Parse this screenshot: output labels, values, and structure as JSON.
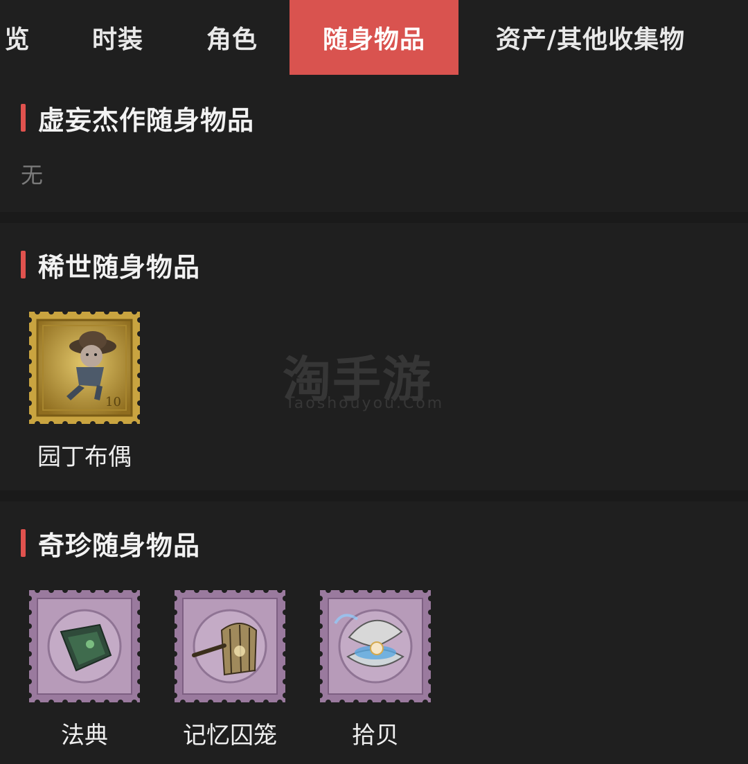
{
  "tabs": [
    {
      "label": "览",
      "active": false
    },
    {
      "label": "时装",
      "active": false
    },
    {
      "label": "角色",
      "active": false
    },
    {
      "label": "随身物品",
      "active": true
    },
    {
      "label": "资产/其他收集物",
      "active": false
    }
  ],
  "sections": [
    {
      "title": "虚妄杰作随身物品",
      "empty_text": "无",
      "items": []
    },
    {
      "title": "稀世随身物品",
      "items": [
        {
          "name": "园丁布偶",
          "rarity": "gold",
          "icon": "gardener-doll-icon"
        }
      ]
    },
    {
      "title": "奇珍随身物品",
      "items": [
        {
          "name": "法典",
          "rarity": "purple",
          "icon": "codex-book-icon"
        },
        {
          "name": "记忆囚笼",
          "rarity": "purple",
          "icon": "memory-cage-bell-icon"
        },
        {
          "name": "拾贝",
          "rarity": "purple",
          "icon": "pearl-shell-icon"
        }
      ]
    }
  ],
  "watermark": {
    "big": "淘手游",
    "small": "Taoshouyou.Com"
  },
  "colors": {
    "accent": "#d9534f",
    "background": "#1f1f1f",
    "divider": "#141414",
    "gold_frame": "#c9a440",
    "purple_frame": "#9a7a9e"
  }
}
